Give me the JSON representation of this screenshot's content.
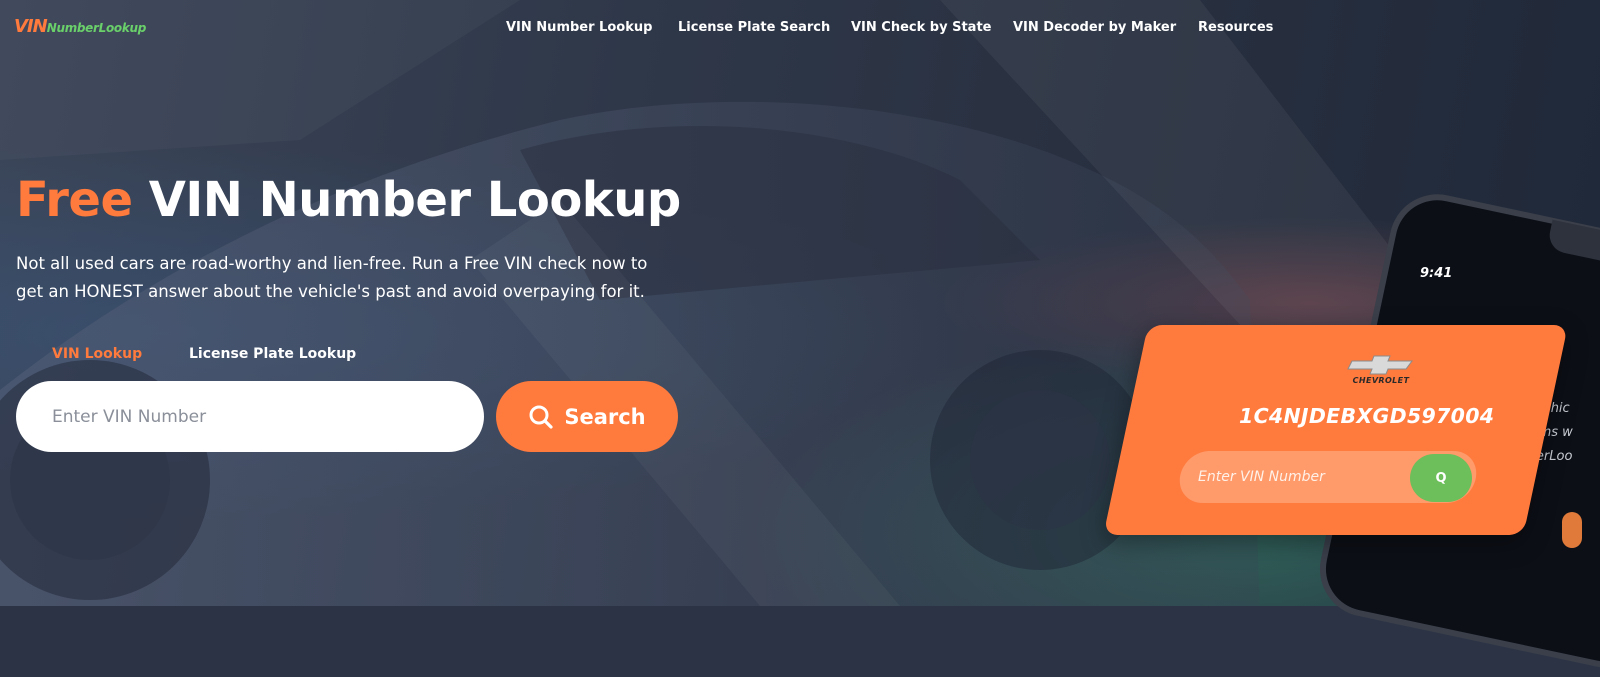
{
  "logo": {
    "prefix": "VIN",
    "suffix": "NumberLookup"
  },
  "nav": {
    "items": [
      {
        "label": "VIN Number Lookup"
      },
      {
        "label": "License Plate Search"
      },
      {
        "label": "VIN Check by State"
      },
      {
        "label": "VIN Decoder by Maker"
      },
      {
        "label": "Resources"
      }
    ]
  },
  "hero": {
    "title_accent": "Free",
    "title_rest": " VIN Number Lookup",
    "subtitle": "Not all used cars are road-worthy and lien-free. Run a Free VIN check now to get an HONEST answer about the vehicle's past and avoid overpaying for it."
  },
  "tabs": [
    {
      "label": "VIN Lookup",
      "active": true
    },
    {
      "label": "License Plate Lookup",
      "active": false
    }
  ],
  "search": {
    "placeholder": "Enter VIN Number",
    "value": "",
    "button_label": "Search",
    "button_icon": "search-icon"
  },
  "phone": {
    "time": "9:41",
    "snippets": [
      "vehic",
      "aims w",
      "mberLoo"
    ]
  },
  "card": {
    "brand": "CHEVROLET",
    "vin": "1C4NJDEBXGD597004",
    "placeholder": "Enter VIN Number",
    "button_label": "Q"
  },
  "colors": {
    "accent": "#ff7a3d",
    "logo_green": "#6ad06a",
    "card_button_green": "#6cbf5a"
  }
}
